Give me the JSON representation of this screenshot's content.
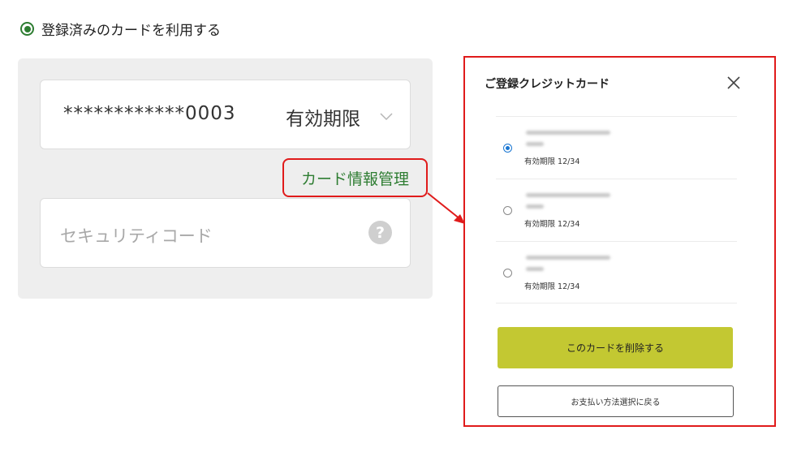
{
  "payment": {
    "use_registered_label": "登録済みのカードを利用する",
    "selected_card_number": "************0003",
    "expiry_label": "有効期限",
    "manage_link_label": "カード情報管理",
    "security_code_placeholder": "セキュリティコード",
    "help_icon_glyph": "?"
  },
  "modal": {
    "title": "ご登録クレジットカード",
    "cards": [
      {
        "expiry": "有効期限 12/34",
        "selected": true
      },
      {
        "expiry": "有効期限 12/34",
        "selected": false
      },
      {
        "expiry": "有効期限 12/34",
        "selected": false
      }
    ],
    "delete_button_label": "このカードを削除する",
    "back_button_label": "お支払い方法選択に戻る"
  },
  "colors": {
    "accent_green": "#2e7d32",
    "delete_button": "#c3c832",
    "highlight_red": "#e01b1b",
    "radio_blue": "#1976d2"
  },
  "icons": [
    "radio-selected-icon",
    "chevron-down-icon",
    "help-icon",
    "close-icon",
    "annotation-arrow"
  ]
}
